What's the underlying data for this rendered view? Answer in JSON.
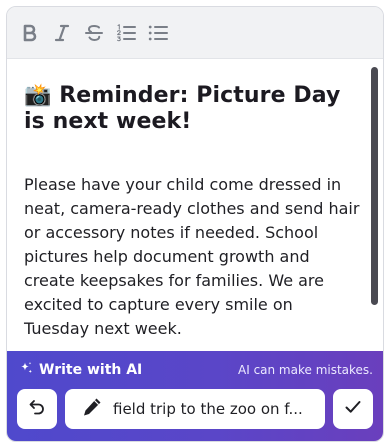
{
  "toolbar": {
    "items": [
      {
        "name": "bold",
        "icon": "bold-icon"
      },
      {
        "name": "italic",
        "icon": "italic-icon"
      },
      {
        "name": "strikethrough",
        "icon": "strikethrough-icon"
      },
      {
        "name": "ordered-list",
        "icon": "ordered-list-icon"
      },
      {
        "name": "bullet-list",
        "icon": "bullet-list-icon"
      }
    ]
  },
  "document": {
    "heading_emoji": "📸",
    "heading": "Reminder: Picture Day is next week!",
    "body": "Please have your child come dressed in neat, camera-ready clothes and send hair or accessory notes if needed. School pictures help document growth and create keepsakes for families. We are excited to capture every smile on Tuesday next week."
  },
  "ai": {
    "title": "Write with AI",
    "disclaimer": "AI can make mistakes.",
    "prompt_value": "field trip to the zoo on f...",
    "undo_icon": "undo-icon",
    "pencil_icon": "pencil-icon",
    "confirm_icon": "checkmark-icon",
    "sparkle_icon": "sparkle-icon"
  },
  "colors": {
    "accent_start": "#4f49cc",
    "accent_end": "#6a3fbd",
    "toolbar_bg": "#f1f2f4",
    "scroll_thumb": "#4a4a52"
  }
}
